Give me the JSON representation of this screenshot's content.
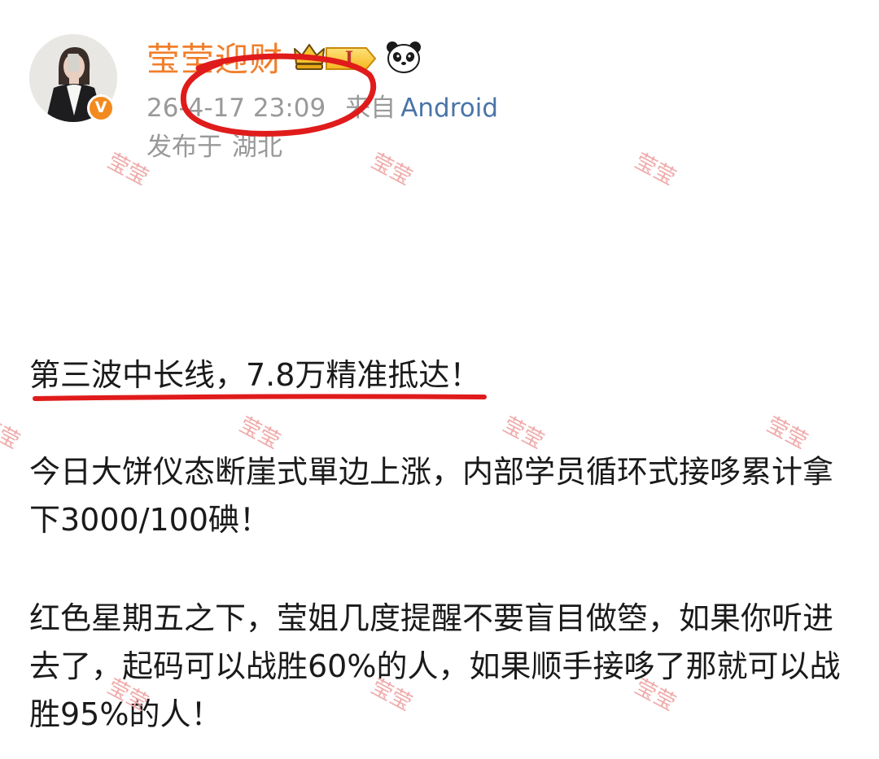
{
  "post": {
    "author": {
      "name": "莹莹迎财",
      "verified_badge": "V",
      "level_badge": "I",
      "avatar_icon": "avatar-photo",
      "crown_icon": "crown-icon",
      "panda_icon": "panda-icon"
    },
    "meta": {
      "timestamp": "26-4-17 23:09",
      "source_label": "来自",
      "source_platform": "Android",
      "location_label": "发布于",
      "location_value": "湖北"
    },
    "content": {
      "headline": "第三波中长线，7.8万精准抵达！",
      "paragraph_1": "今日大饼仪态断崖式單边上涨，内部学员循环式接哆累计拿下3000/100碘！",
      "paragraph_2": "红色星期五之下，莹姐几度提醒不要盲目做箜，如果你听进去了，起码可以战胜60%的人，如果顺手接哆了那就可以战胜95%的人！"
    }
  },
  "watermark": {
    "text": "莹莹"
  },
  "colors": {
    "username": "#f07f2c",
    "meta_gray": "#999999",
    "platform_blue": "#4a74a8",
    "body_text": "#1a1a1a",
    "annotation_red": "#e01b1b",
    "watermark": "#f0aaaa",
    "verified_orange": "#f38a20"
  }
}
